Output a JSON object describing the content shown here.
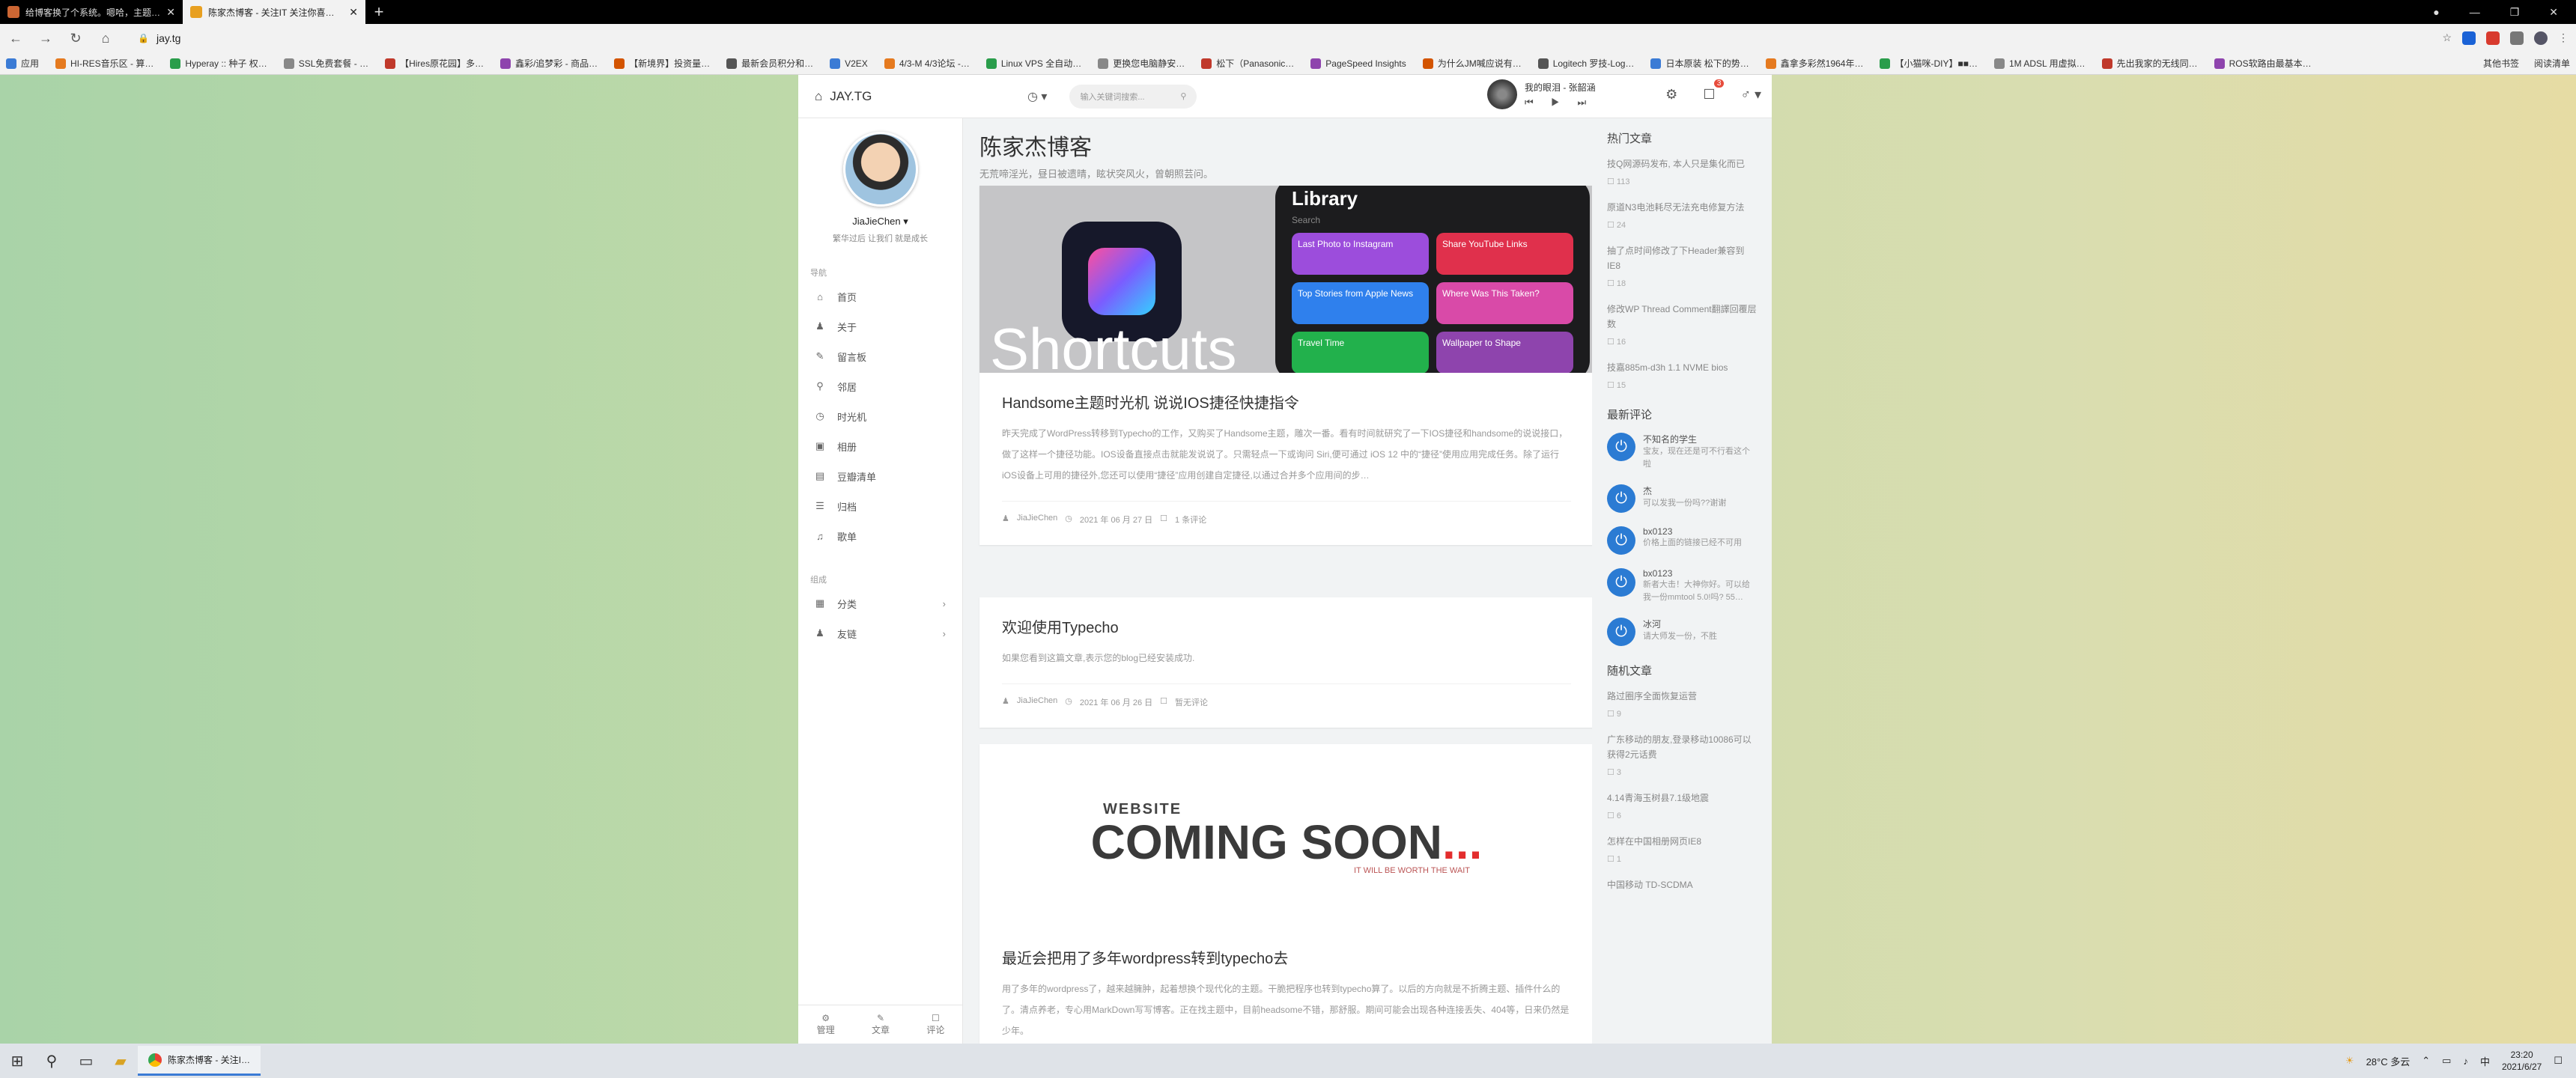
{
  "browser": {
    "tabs": [
      {
        "title": "给博客换了个系统。嗯哈，主题…",
        "active": false,
        "favicon_color": "#cc6633"
      },
      {
        "title": "陈家杰博客 - 关注IT 关注你喜欢…",
        "active": true,
        "favicon_color": "#e8a020"
      }
    ],
    "url": "jay.tg",
    "bookmarks": [
      "应用",
      "HI-RES音乐区 - 算…",
      "Hyperay :: 种子 权…",
      "SSL免费套餐 - …",
      "【Hires原花园】多…",
      "鑫彩/追梦彩 - 商品…",
      "【新境界】投资量…",
      "最新会员积分和…",
      "V2EX",
      "4/3-M 4/3论坛 -…",
      "Linux VPS 全自动…",
      "更换您电脑静安…",
      "松下（Panasonic…",
      "PageSpeed Insights",
      "为什么JM喊应说有…",
      "Logitech 罗技-Log…",
      "日本原装 松下的势…",
      "鑫拿多彩然1964年…",
      "【小猫咪-DIY】■■…",
      "1M ADSL 用虚拟…",
      "先出我家的无线同…",
      "ROS软路由最基本…"
    ],
    "bookmarks_right": [
      "其他书签",
      "阅读清单"
    ]
  },
  "site": {
    "brand": "JAY.TG",
    "search_placeholder": "输入关键词搜索...",
    "player": {
      "title": "我的眼泪 - 张韶涵",
      "controls": "⏮ ▶ ⏭"
    },
    "notif_count": "3",
    "profile": {
      "name": "JiaJieChen ▾",
      "motto": "繁华过后 让我们 就是成长"
    },
    "nav_section": "导航",
    "nav": [
      {
        "icon": "⌂",
        "label": "首页",
        "icon_name": "home-icon"
      },
      {
        "icon": "♟",
        "label": "关于",
        "icon_name": "user-icon"
      },
      {
        "icon": "✎",
        "label": "留言板",
        "icon_name": "edit-icon"
      },
      {
        "icon": "⚲",
        "label": "邻居",
        "icon_name": "link-icon"
      },
      {
        "icon": "◷",
        "label": "时光机",
        "icon_name": "clock-icon"
      },
      {
        "icon": "▣",
        "label": "相册",
        "icon_name": "camera-icon"
      },
      {
        "icon": "▤",
        "label": "豆瓣清单",
        "icon_name": "list-icon"
      },
      {
        "icon": "☰",
        "label": "归档",
        "icon_name": "archive-icon"
      },
      {
        "icon": "♫",
        "label": "歌单",
        "icon_name": "music-icon"
      }
    ],
    "group_section": "组成",
    "groups": [
      {
        "icon": "▦",
        "label": "分类",
        "arrow": "›",
        "icon_name": "category-icon"
      },
      {
        "icon": "♟",
        "label": "友链",
        "arrow": "›",
        "icon_name": "friends-icon"
      }
    ],
    "aside_footer": [
      {
        "icon": "⚙",
        "label": "管理"
      },
      {
        "icon": "✎",
        "label": "文章"
      },
      {
        "icon": "☐",
        "label": "评论"
      }
    ],
    "blog_title": "陈家杰博客",
    "blog_subtitle": "无荒啼淫光，昼日被遗晴，眩状突风火，曾朝照芸问。",
    "posts": [
      {
        "title": "Handsome主题时光机 说说IOS捷径快捷指令",
        "excerpt": "昨天完成了WordPress转移到Typecho的工作，又购买了Handsome主题，雕次一番。看有时间就研究了一下IOS捷径和handsome的说说接口，做了这样一个捷径功能。IOS设备直接点击就能发说说了。只需轻点一下或询问 Siri,便可通过 iOS 12 中的“捷径”使用应用完成任务。除了运行 iOS设备上可用的捷径外,您还可以使用“捷径”应用创建自定捷径,以通过合并多个应用间的步…",
        "author": "JiaJieChen",
        "date": "2021 年 06 月 27 日",
        "comments": "1 条评论"
      },
      {
        "title": "欢迎使用Typecho",
        "excerpt": "如果您看到这篇文章,表示您的blog已经安装成功.",
        "author": "JiaJieChen",
        "date": "2021 年 06 月 26 日",
        "comments": "暂无评论"
      },
      {
        "title": "最近会把用了多年wordpress转到typecho去",
        "excerpt": "用了多年的wordpress了，越来越臃肿，起着想换个现代化的主题。干脆把程序也转到typecho算了。以后的方向就是不折腾主题、插件什么的了。清点养老，专心用MarkDown写写博客。正在找主题中，目前headsome不错，那舒服。期间可能会出现各种连接丢失、404等，日来仍然是少年。",
        "author": "",
        "date": "",
        "comments": ""
      }
    ],
    "shortcuts_img": {
      "word": "Shortcuts",
      "library": "Library",
      "search": "Search",
      "tiles": [
        {
          "label": "Last Photo to Instagram",
          "color": "#9c4ddc"
        },
        {
          "label": "Share YouTube Links",
          "color": "#e0304c"
        },
        {
          "label": "Top Stories from Apple News",
          "color": "#2f80ed"
        },
        {
          "label": "Where Was This Taken?",
          "color": "#d94aa8"
        },
        {
          "label": "Travel Time",
          "color": "#22b14c"
        },
        {
          "label": "Wallpaper to Shape",
          "color": "#8e44ad"
        }
      ]
    },
    "coming_soon": {
      "top": "WEBSITE",
      "main": "COMING SOON",
      "dots": "...",
      "tag": "IT WILL BE WORTH THE WAIT"
    },
    "hot_title": "热门文章",
    "hot": [
      {
        "title": "技Q网源码发布, 本人只是集化而已",
        "count": "113"
      },
      {
        "title": "原道N3电池耗尽无法充电修复方法",
        "count": "24"
      },
      {
        "title": "抽了点时间修改了下Header兼容到IE8",
        "count": "18"
      },
      {
        "title": "修改WP Thread Comment翻譯回覆层数",
        "count": "16"
      },
      {
        "title": "技嘉885m-d3h 1.1 NVME bios",
        "count": "15"
      }
    ],
    "comments_title": "最新评论",
    "comments": [
      {
        "name": "不知名的学生",
        "text": "宝友，现在还是可不行看这个啦"
      },
      {
        "name": "杰",
        "text": "可以发我一份吗??谢谢"
      },
      {
        "name": "bx0123",
        "text": "价格上面的链接已经不可用"
      },
      {
        "name": "bx0123",
        "text": "新者大击！大神你好。可以给我一份mmtool 5.0!吗? 55…"
      },
      {
        "name": "冰河",
        "text": "请大师发一份，不胜"
      }
    ],
    "random_title": "随机文章",
    "random": [
      {
        "title": "路过圈序全面恢复运营",
        "count": "9"
      },
      {
        "title": "广东移动的朋友,登录移动10086可以获得2元话费",
        "count": "3"
      },
      {
        "title": "4.14青海玉树县7.1级地震",
        "count": "6"
      },
      {
        "title": "怎样在中国相册网页IE8",
        "count": "1"
      },
      {
        "title": "中国移动 TD-SCDMA",
        "count": ""
      }
    ]
  },
  "taskbar": {
    "app": "陈家杰博客 - 关注I…",
    "weather": "28°C 多云",
    "ime": "中",
    "time": "23:20",
    "date": "2021/6/27"
  }
}
